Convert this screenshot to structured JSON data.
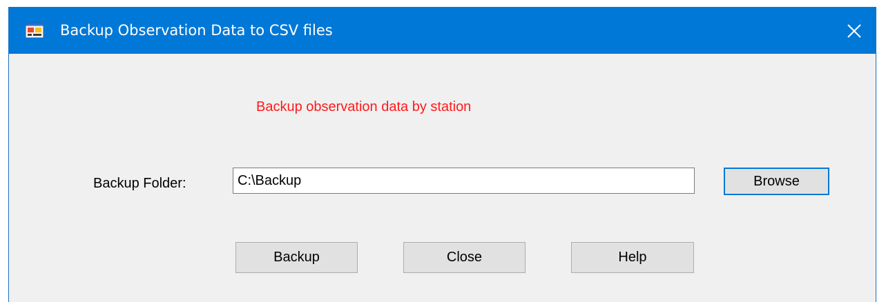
{
  "window": {
    "title": "Backup Observation Data to CSV files",
    "title_icon": "form-app-icon",
    "close_icon": "close-icon"
  },
  "form": {
    "subtitle": "Backup observation data by station",
    "folder_label": "Backup Folder:",
    "folder_value": "C:\\Backup",
    "browse_label": "Browse",
    "backup_label": "Backup",
    "close_label": "Close",
    "help_label": "Help"
  },
  "colors": {
    "titlebar": "#0078d7",
    "subtitle": "#ff1a1a",
    "dialog_bg": "#f0f0f0",
    "button_bg": "#e1e1e1",
    "default_button_border": "#0078d7"
  }
}
